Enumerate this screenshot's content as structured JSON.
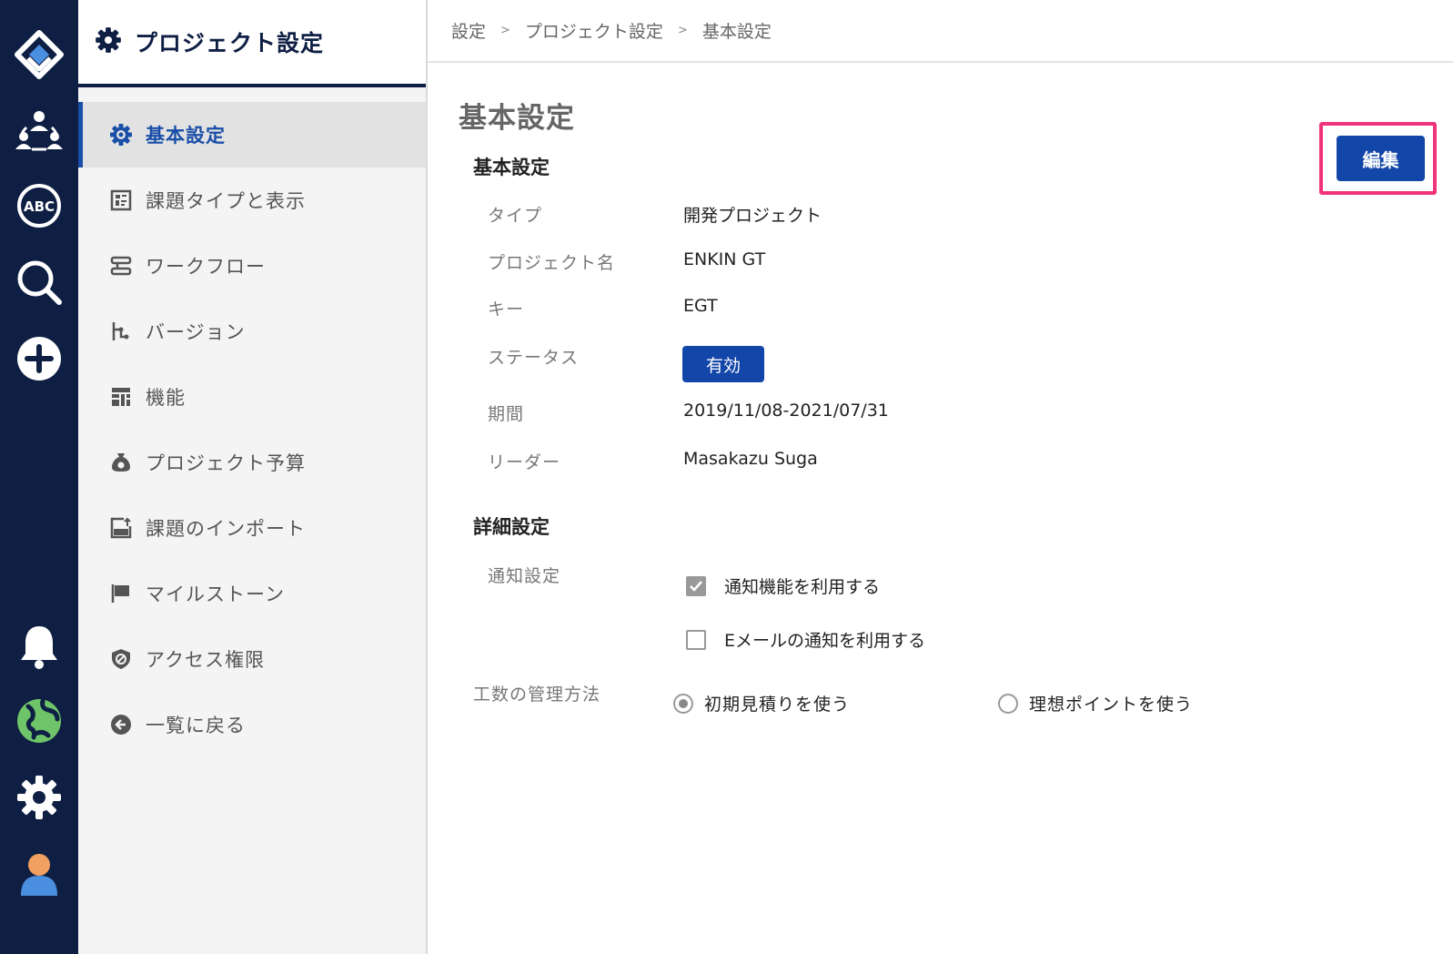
{
  "rail": {
    "items": [
      {
        "name": "logo-icon"
      },
      {
        "name": "team-icon"
      },
      {
        "name": "abc-icon",
        "text": "ABC"
      },
      {
        "name": "search-icon"
      },
      {
        "name": "add-icon"
      },
      {
        "name": "bell-icon"
      },
      {
        "name": "globe-icon"
      },
      {
        "name": "gear-icon"
      },
      {
        "name": "user-avatar-icon"
      }
    ]
  },
  "sidebar": {
    "title": "プロジェクト設定",
    "items": [
      {
        "label": "基本設定",
        "icon": "gear-icon",
        "active": true
      },
      {
        "label": "課題タイプと表示",
        "icon": "issue-type-icon"
      },
      {
        "label": "ワークフロー",
        "icon": "workflow-icon"
      },
      {
        "label": "バージョン",
        "icon": "version-icon"
      },
      {
        "label": "機能",
        "icon": "feature-icon"
      },
      {
        "label": "プロジェクト予算",
        "icon": "budget-icon"
      },
      {
        "label": "課題のインポート",
        "icon": "csv-import-icon"
      },
      {
        "label": "マイルストーン",
        "icon": "flag-icon"
      },
      {
        "label": "アクセス権限",
        "icon": "shield-icon"
      },
      {
        "label": "一覧に戻る",
        "icon": "back-arrow-icon"
      }
    ]
  },
  "breadcrumb": [
    "設定",
    "プロジェクト設定",
    "基本設定"
  ],
  "breadcrumb_sep": ">",
  "page_title": "基本設定",
  "edit_button": "編集",
  "basic": {
    "title": "基本設定",
    "rows": [
      {
        "label": "タイプ",
        "value": "開発プロジェクト"
      },
      {
        "label": "プロジェクト名",
        "value": "ENKIN GT"
      },
      {
        "label": "キー",
        "value": "EGT"
      },
      {
        "label": "ステータス",
        "value": "有効"
      },
      {
        "label": "期間",
        "value": "2019/11/08-2021/07/31"
      },
      {
        "label": "リーダー",
        "value": "Masakazu Suga"
      }
    ]
  },
  "detail": {
    "title": "詳細設定",
    "notify_label": "通知設定",
    "notify_options": [
      {
        "label": "通知機能を利用する",
        "checked": true
      },
      {
        "label": "Eメールの通知を利用する",
        "checked": false
      }
    ],
    "effort_label": "工数の管理方法",
    "effort_options": [
      {
        "label": "初期見積りを使う",
        "selected": true
      },
      {
        "label": "理想ポイントを使う",
        "selected": false
      }
    ]
  },
  "colors": {
    "navy": "#0f1f44",
    "accent": "#1246a8",
    "highlight": "#f0337a"
  }
}
